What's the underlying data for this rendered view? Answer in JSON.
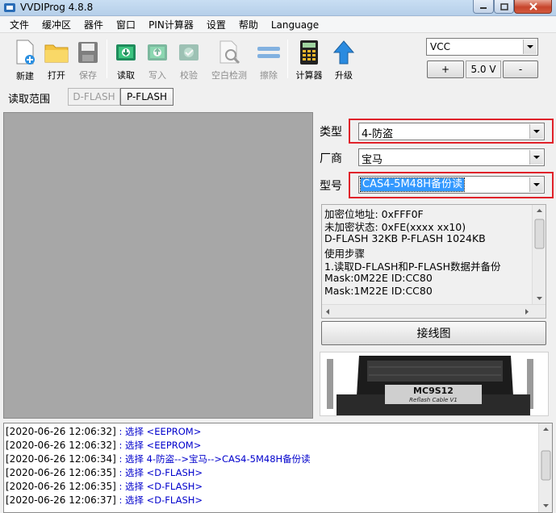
{
  "window": {
    "title": "VVDIProg 4.8.8"
  },
  "menu": [
    "文件",
    "缓冲区",
    "器件",
    "窗口",
    "PIN计算器",
    "设置",
    "帮助",
    "Language"
  ],
  "toolbar": [
    {
      "label": "新建",
      "icon": "new-file-icon",
      "enabled": true
    },
    {
      "label": "打开",
      "icon": "open-folder-icon",
      "enabled": true
    },
    {
      "label": "保存",
      "icon": "save-disk-icon",
      "enabled": false
    },
    {
      "label": "读取",
      "icon": "read-chip-icon",
      "enabled": true
    },
    {
      "label": "写入",
      "icon": "write-chip-icon",
      "enabled": false
    },
    {
      "label": "校验",
      "icon": "verify-chip-icon",
      "enabled": false
    },
    {
      "label": "空白检测",
      "icon": "blank-check-icon",
      "enabled": false
    },
    {
      "label": "擦除",
      "icon": "erase-icon",
      "enabled": false
    },
    {
      "label": "计算器",
      "icon": "calculator-icon",
      "enabled": true
    },
    {
      "label": "升级",
      "icon": "upgrade-arrow-icon",
      "enabled": true
    }
  ],
  "vcc": {
    "selected": "VCC",
    "plus": "+",
    "value": "5.0 V",
    "minus": "-"
  },
  "read_range": {
    "label": "读取范围",
    "dflash": "D-FLASH",
    "pflash": "P-FLASH"
  },
  "config": {
    "type_label": "类型",
    "type_value": "4-防盗",
    "make_label": "厂商",
    "make_value": "宝马",
    "model_label": "型号",
    "model_value": "CAS4-5M48H备份读",
    "info": [
      "加密位地址: 0xFFF0F",
      "未加密状态: 0xFE(xxxx xx10)",
      "D-FLASH 32KB P-FLASH 1024KB",
      "使用步骤",
      "1.读取D-FLASH和P-FLASH数据并备份",
      "Mask:0M22E ID:CC80",
      "Mask:1M22E ID:CC80"
    ],
    "wiring_button": "接线图",
    "cable_text1": "MC9S12",
    "cable_text2": "Reflash Cable V1"
  },
  "log": [
    {
      "ts": "[2020-06-26 12:06:32]",
      "msg": " : 选择 <EEPROM>"
    },
    {
      "ts": "[2020-06-26 12:06:32]",
      "msg": " : 选择 <EEPROM>"
    },
    {
      "ts": "[2020-06-26 12:06:34]",
      "msg": " : 选择 4-防盗-->宝马-->CAS4-5M48H备份读"
    },
    {
      "ts": "[2020-06-26 12:06:35]",
      "msg": " : 选择 <D-FLASH>"
    },
    {
      "ts": "[2020-06-26 12:06:35]",
      "msg": " : 选择 <D-FLASH>"
    },
    {
      "ts": "[2020-06-26 12:06:37]",
      "msg": " : 选择 <D-FLASH>"
    }
  ],
  "colors": {
    "highlight_box": "#e0222a",
    "selection": "#3399ff",
    "log_message": "#0000cc"
  }
}
